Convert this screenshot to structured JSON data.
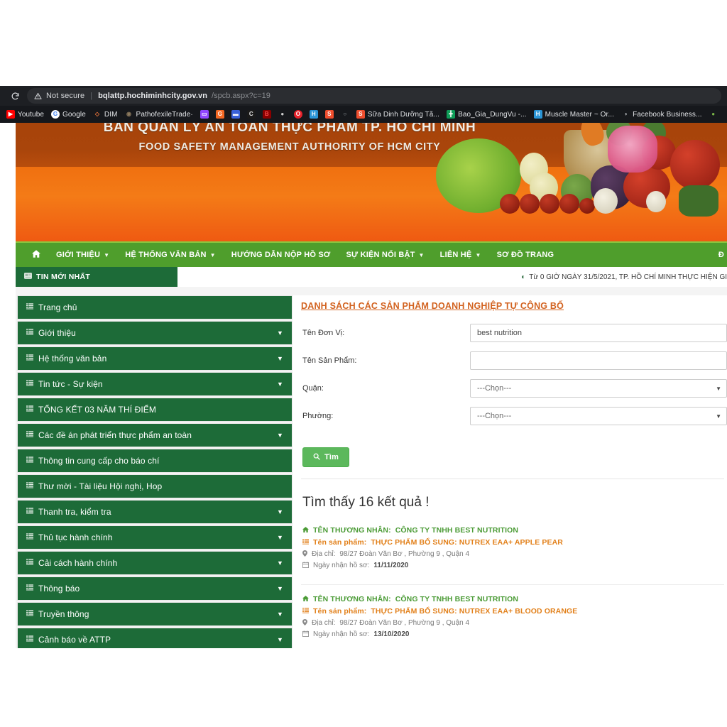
{
  "browser": {
    "reload_icon": "reload-icon",
    "security_icon": "warning-triangle-icon",
    "security_label": "Not secure",
    "url_host": "bqlattp.hochiminhcity.gov.vn",
    "url_path": "/spcb.aspx?c=19",
    "bookmarks": [
      {
        "label": "Youtube",
        "icon": "youtube-icon",
        "glyph": "▶",
        "bg": "#ff0000",
        "fg": "#ffffff",
        "round": false
      },
      {
        "label": "Google",
        "icon": "google-icon",
        "glyph": "G",
        "bg": "#ffffff",
        "fg": "#4285f4",
        "round": true
      },
      {
        "label": "DIM",
        "icon": "dim-icon",
        "glyph": "◇",
        "bg": "#16181c",
        "fg": "#e8743b",
        "round": false
      },
      {
        "label": "PathofexileTrade·",
        "icon": "poe-icon",
        "glyph": "◉",
        "bg": "#16181c",
        "fg": "#8c7a5e",
        "round": false
      },
      {
        "label": "",
        "icon": "twitch-icon",
        "glyph": "▭",
        "bg": "#9146ff",
        "fg": "#ffffff",
        "round": false
      },
      {
        "label": "",
        "icon": "grammarly-icon",
        "glyph": "G",
        "bg": "#f26722",
        "fg": "#ffffff",
        "round": false
      },
      {
        "label": "",
        "icon": "blue-app-icon",
        "glyph": "▬",
        "bg": "#3a62d8",
        "fg": "#ffffff",
        "round": false
      },
      {
        "label": "",
        "icon": "c-bracket-icon",
        "glyph": "C",
        "bg": "#1a1a1a",
        "fg": "#e6e6e6",
        "round": false
      },
      {
        "label": "",
        "icon": "bs-red-icon",
        "glyph": "B",
        "bg": "#8b0000",
        "fg": "#ff4d4d",
        "round": false
      },
      {
        "label": "",
        "icon": "dark-oval-icon",
        "glyph": "●",
        "bg": "#16181c",
        "fg": "#cfcfcf",
        "round": false
      },
      {
        "label": "",
        "icon": "opera-icon",
        "glyph": "O",
        "bg": "#e8232c",
        "fg": "#ffffff",
        "round": true
      },
      {
        "label": "",
        "icon": "h-blue-icon",
        "glyph": "H",
        "bg": "#2b95d6",
        "fg": "#ffffff",
        "round": false
      },
      {
        "label": "",
        "icon": "shopee-icon",
        "glyph": "S",
        "bg": "#ee4d2d",
        "fg": "#ffffff",
        "round": false
      },
      {
        "label": "",
        "icon": "github-icon",
        "glyph": "○",
        "bg": "#16181c",
        "fg": "#9aa0a6",
        "round": true
      },
      {
        "label": "Sữa Dinh Dưỡng Tã...",
        "icon": "shopee-icon",
        "glyph": "S",
        "bg": "#ee4d2d",
        "fg": "#ffffff",
        "round": false
      },
      {
        "label": "Bao_Gia_DungVu -...",
        "icon": "google-sheets-icon",
        "glyph": "╋",
        "bg": "#0f9d58",
        "fg": "#ffffff",
        "round": false
      },
      {
        "label": "Muscle Master ~ Or...",
        "icon": "h-blue-icon",
        "glyph": "H",
        "bg": "#2b95d6",
        "fg": "#ffffff",
        "round": false
      },
      {
        "label": "Facebook Business...",
        "icon": "facebook-business-icon",
        "glyph": "◑",
        "bg": "#16181c",
        "fg": "#b9bcc0",
        "round": true
      },
      {
        "label": "",
        "icon": "green-app-icon",
        "glyph": "●",
        "bg": "#16181c",
        "fg": "#7ab648",
        "round": false
      }
    ]
  },
  "site": {
    "banner": {
      "title_vi": "BAN QUẢN LÝ AN TOÀN THỰC PHẨM TP. HỒ CHÍ MINH",
      "title_en": "FOOD SAFETY MANAGEMENT AUTHORITY OF HCM CITY"
    },
    "navbar": {
      "items": [
        {
          "label": "",
          "icon": "home-icon",
          "has_caret": false
        },
        {
          "label": "GIỚI THIỆU",
          "icon": "",
          "has_caret": true
        },
        {
          "label": "HỆ THỐNG VĂN BẢN",
          "icon": "",
          "has_caret": true
        },
        {
          "label": "HƯỚNG DẪN NỘP HỒ SƠ",
          "icon": "",
          "has_caret": false
        },
        {
          "label": "SỰ KIỆN NỔI BẬT",
          "icon": "",
          "has_caret": true
        },
        {
          "label": "LIÊN HỆ",
          "icon": "",
          "has_caret": true
        },
        {
          "label": "SƠ ĐỒ TRANG",
          "icon": "",
          "has_caret": false
        }
      ],
      "right_item": "Đ"
    },
    "ticker": {
      "tag_label": "TIN MỚI NHẤT",
      "tag_icon": "news-icon",
      "message": "Từ 0 GIỜ NGÀY 31/5/2021, TP. HỒ CHÍ MINH THỰC HIỆN GI"
    },
    "sidebar": {
      "items": [
        {
          "label": "Trang chủ",
          "has_caret": false
        },
        {
          "label": "Giới thiệu",
          "has_caret": true
        },
        {
          "label": "Hệ thống văn bản",
          "has_caret": true
        },
        {
          "label": "Tin tức - Sự kiện",
          "has_caret": true
        },
        {
          "label": "TỔNG KẾT 03 NĂM THÍ ĐIỂM",
          "has_caret": false
        },
        {
          "label": "Các đề án phát triển thực phẩm an toàn",
          "has_caret": true
        },
        {
          "label": "Thông tin cung cấp cho báo chí",
          "has_caret": false
        },
        {
          "label": "Thư mời - Tài liệu Hội nghị, Hop",
          "has_caret": false
        },
        {
          "label": "Thanh tra, kiểm tra",
          "has_caret": true
        },
        {
          "label": "Thủ tục hành chính",
          "has_caret": true
        },
        {
          "label": "Cải cách hành chính",
          "has_caret": true
        },
        {
          "label": "Thông báo",
          "has_caret": true
        },
        {
          "label": "Truyền thông",
          "has_caret": true
        },
        {
          "label": "Cảnh báo về ATTP",
          "has_caret": true
        },
        {
          "label": "",
          "has_caret": false
        }
      ]
    },
    "main": {
      "page_title": "DANH SÁCH CÁC SẢN PHẨM DOANH NGHIỆP TỰ CÔNG BỐ",
      "form": {
        "unit_name_label": "Tên Đơn Vị:",
        "unit_name_value": "best nutrition",
        "product_name_label": "Tên Sản Phẩm:",
        "product_name_value": "",
        "district_label": "Quận:",
        "district_value": "---Chọn---",
        "ward_label": "Phường:",
        "ward_value": "---Chọn---",
        "search_button": "Tìm",
        "search_icon": "magnifier-icon"
      },
      "results_count_text": "Tìm thấy 16 kết quả !",
      "labels": {
        "merchant_prefix": "TÊN THƯƠNG NHÂN:",
        "product_prefix": "Tên sản phẩm:",
        "address_prefix": "Địa chỉ:",
        "date_prefix": "Ngày nhận hồ sơ:"
      },
      "results": [
        {
          "merchant": "CÔNG TY TNHH BEST NUTRITION",
          "product": "THỰC PHẨM BỔ SUNG: NUTREX EAA+ APPLE PEAR",
          "address": "98/27 Đoàn Văn Bơ , Phường 9 , Quận 4",
          "date": "11/11/2020"
        },
        {
          "merchant": "CÔNG TY TNHH BEST NUTRITION",
          "product": "THỰC PHẨM BỔ SUNG: NUTREX EAA+ BLOOD ORANGE",
          "address": "98/27 Đoàn Văn Bơ , Phường 9 , Quận 4",
          "date": "13/10/2020"
        }
      ]
    }
  },
  "colors": {
    "nav_green": "#4f9e2c",
    "sidebar_green": "#1d6b38",
    "title_orange": "#d2621f",
    "merchant_green": "#4b9b36",
    "product_orange": "#e2801a",
    "button_green": "#5cb85c"
  }
}
